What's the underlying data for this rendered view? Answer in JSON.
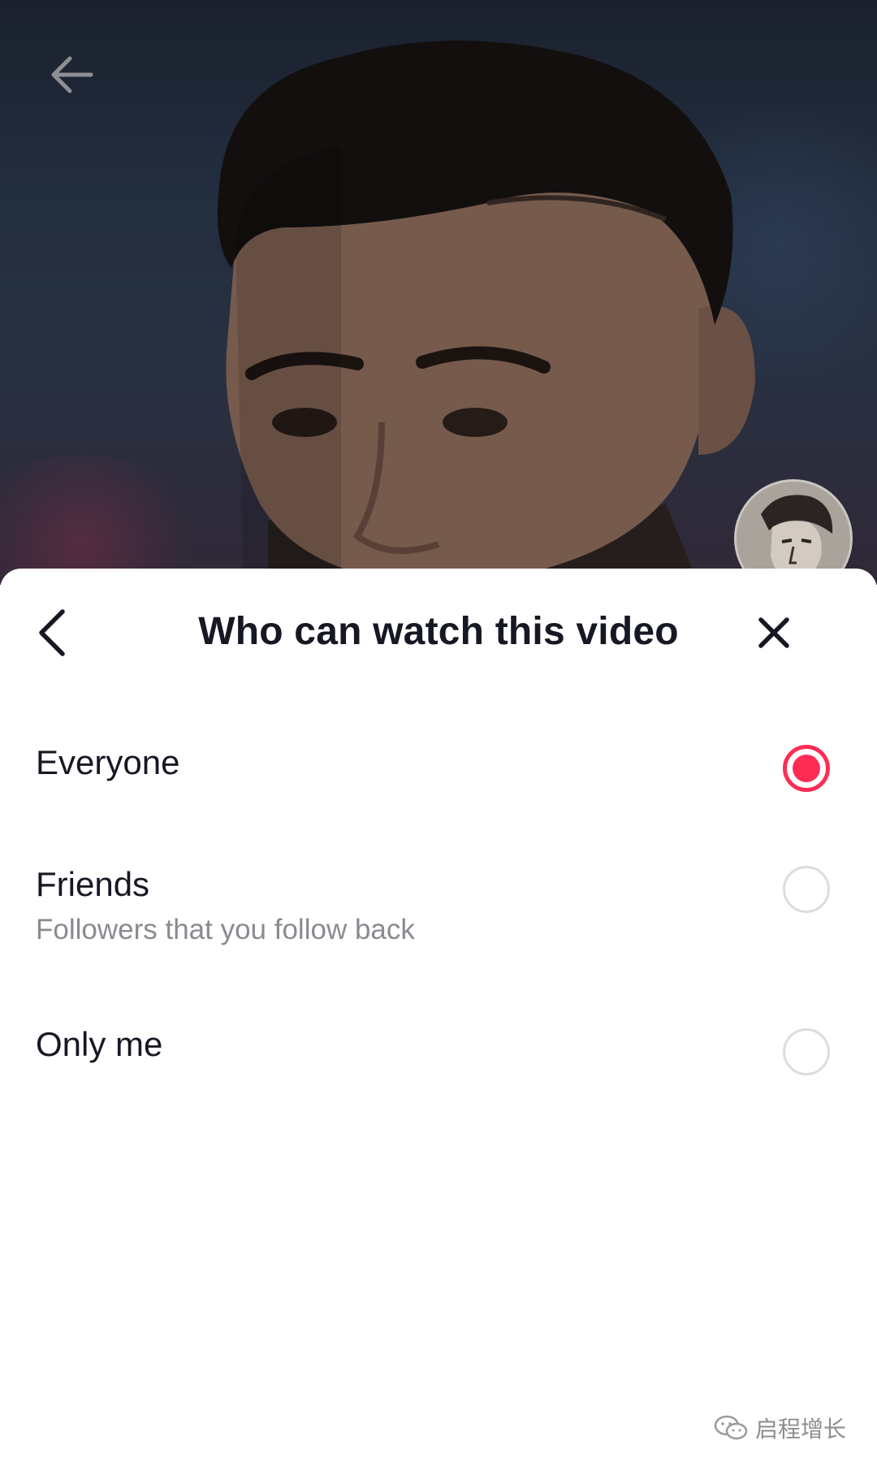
{
  "sheet": {
    "title": "Who can watch this video"
  },
  "options": [
    {
      "label": "Everyone",
      "subtitle": "",
      "selected": true
    },
    {
      "label": "Friends",
      "subtitle": "Followers that you follow back",
      "selected": false
    },
    {
      "label": "Only me",
      "subtitle": "",
      "selected": false
    }
  ],
  "icons": {
    "back": "arrow-left-icon",
    "sheet_back": "chevron-left-icon",
    "close": "close-icon",
    "watermark": "wechat-icon"
  },
  "colors": {
    "accent": "#fe2c55",
    "title_text": "#161823",
    "subtitle_text": "#8a8b91"
  },
  "watermark": {
    "text": "启程增长"
  }
}
